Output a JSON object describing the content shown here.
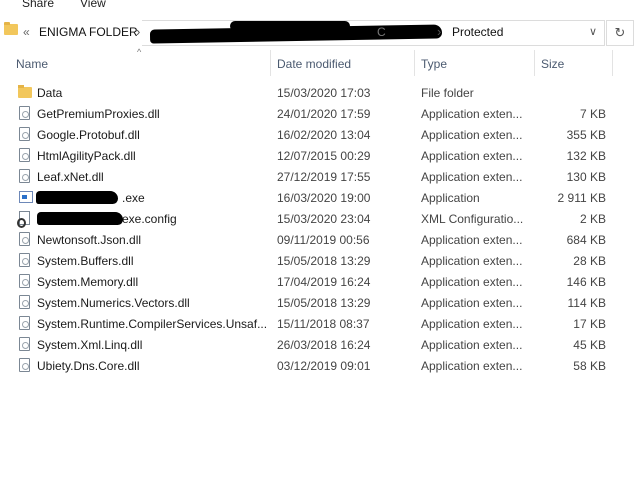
{
  "ribbon": {
    "share": "Share",
    "view": "View"
  },
  "address": {
    "prefix": "«",
    "folder": "ENIGMA FOLDER",
    "partial": "C",
    "current": "Protected",
    "refresh_glyph": "↻"
  },
  "columns": {
    "name": "Name",
    "date": "Date modified",
    "type": "Type",
    "size": "Size"
  },
  "files": [
    {
      "name": "Data",
      "date": "15/03/2020 17:03",
      "type": "File folder",
      "size": "",
      "icon": "folder-icon"
    },
    {
      "name": "GetPremiumProxies.dll",
      "date": "24/01/2020 17:59",
      "type": "Application exten...",
      "size": "7 KB",
      "icon": "dll-file-icon"
    },
    {
      "name": "Google.Protobuf.dll",
      "date": "16/02/2020 13:04",
      "type": "Application exten...",
      "size": "355 KB",
      "icon": "dll-file-icon"
    },
    {
      "name": "HtmlAgilityPack.dll",
      "date": "12/07/2015 00:29",
      "type": "Application exten...",
      "size": "132 KB",
      "icon": "dll-file-icon"
    },
    {
      "name": "Leaf.xNet.dll",
      "date": "27/12/2019 17:55",
      "type": "Application exten...",
      "size": "130 KB",
      "icon": "dll-file-icon"
    },
    {
      "name": ".exe",
      "date": "16/03/2020 19:00",
      "type": "Application",
      "size": "2 911 KB",
      "icon": "application-icon"
    },
    {
      "name": "exe.config",
      "date": "15/03/2020 23:04",
      "type": "XML Configuratio...",
      "size": "2 KB",
      "icon": "config-file-icon"
    },
    {
      "name": "Newtonsoft.Json.dll",
      "date": "09/11/2019 00:56",
      "type": "Application exten...",
      "size": "684 KB",
      "icon": "dll-file-icon"
    },
    {
      "name": "System.Buffers.dll",
      "date": "15/05/2018 13:29",
      "type": "Application exten...",
      "size": "28 KB",
      "icon": "dll-file-icon"
    },
    {
      "name": "System.Memory.dll",
      "date": "17/04/2019 16:24",
      "type": "Application exten...",
      "size": "146 KB",
      "icon": "dll-file-icon"
    },
    {
      "name": "System.Numerics.Vectors.dll",
      "date": "15/05/2018 13:29",
      "type": "Application exten...",
      "size": "114 KB",
      "icon": "dll-file-icon"
    },
    {
      "name": "System.Runtime.CompilerServices.Unsaf...",
      "date": "15/11/2018 08:37",
      "type": "Application exten...",
      "size": "17 KB",
      "icon": "dll-file-icon"
    },
    {
      "name": "System.Xml.Linq.dll",
      "date": "26/03/2018 16:24",
      "type": "Application exten...",
      "size": "45 KB",
      "icon": "dll-file-icon"
    },
    {
      "name": "Ubiety.Dns.Core.dll",
      "date": "03/12/2019 09:01",
      "type": "Application exten...",
      "size": "58 KB",
      "icon": "dll-file-icon"
    }
  ]
}
